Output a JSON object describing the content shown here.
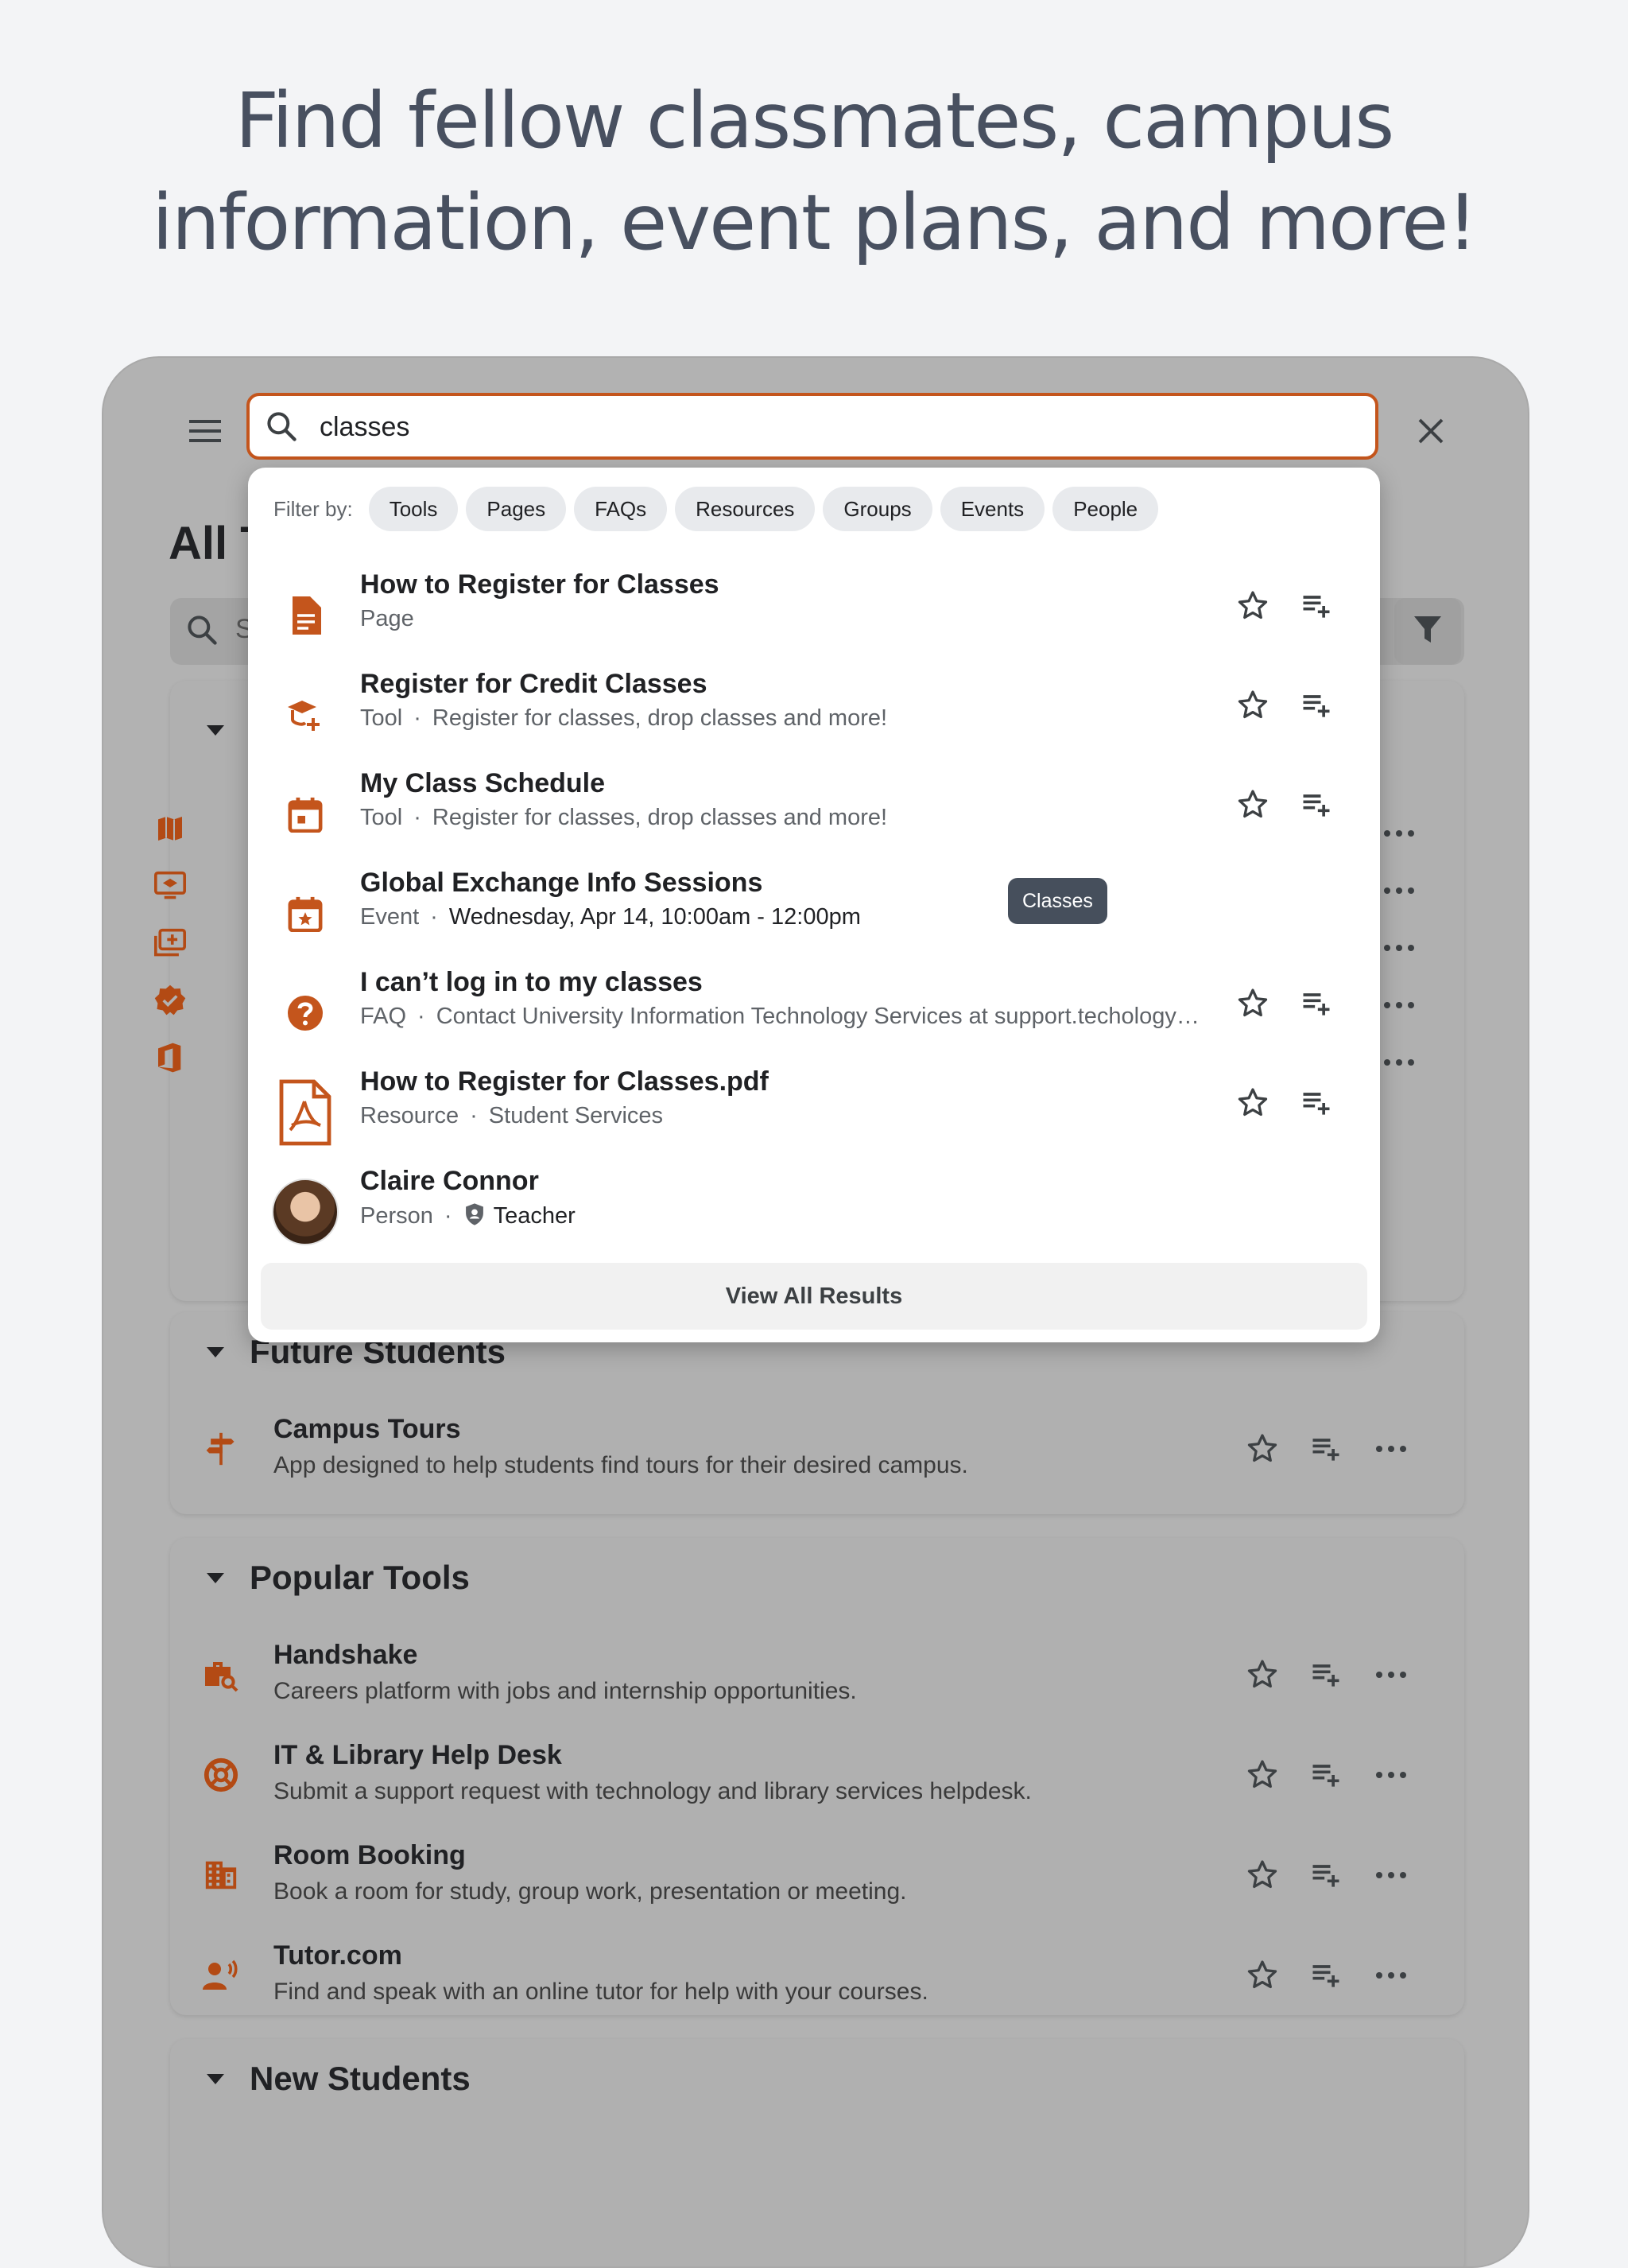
{
  "headline": {
    "line1": "Find fellow classmates, campus",
    "line2": "information, event plans, and more!"
  },
  "colors": {
    "accent": "#c4551c",
    "tooltip_bg": "#464f5c",
    "overlay": "#b2b2b2"
  },
  "topbar": {
    "menu_icon": "hamburger-menu-icon",
    "search_value": "classes",
    "close_icon": "close-icon"
  },
  "page": {
    "title_visible": "All T",
    "search_placeholder_visible": "S"
  },
  "dropdown": {
    "filter_label": "Filter by:",
    "filters": [
      "Tools",
      "Pages",
      "FAQs",
      "Resources",
      "Groups",
      "Events",
      "People"
    ],
    "results": [
      {
        "icon": "document-icon",
        "title": "How to Register for Classes",
        "type": "Page",
        "detail": ""
      },
      {
        "icon": "graduation-cap-add-icon",
        "title": "Register for Credit Classes",
        "type": "Tool",
        "detail": "Register for classes, drop classes and more!"
      },
      {
        "icon": "calendar-icon",
        "title": "My Class Schedule",
        "type": "Tool",
        "detail": "Register for classes, drop classes and more!"
      },
      {
        "icon": "calendar-star-icon",
        "title": "Global Exchange Info Sessions",
        "type": "Event",
        "detail": "Wednesday, Apr 14, 10:00am - 12:00pm"
      },
      {
        "icon": "help-circle-icon",
        "title": "I can’t log in to my classes",
        "type": "FAQ",
        "detail": "Contact University Information Technology Services at support.techology…"
      },
      {
        "icon": "pdf-file-icon",
        "title": "How to Register for Classes.pdf",
        "type": "Resource",
        "detail": "Student Services"
      },
      {
        "icon": "avatar",
        "title": "Claire Connor",
        "type": "Person",
        "detail": "Teacher",
        "detail_icon": "shield-person-icon"
      }
    ],
    "tooltip": "Classes",
    "view_all": "View All Results"
  },
  "sections": {
    "future": {
      "title": "Future Students",
      "items": [
        {
          "icon": "signpost-icon",
          "title": "Campus Tours",
          "desc": "App designed to help students find tours for their desired campus."
        }
      ]
    },
    "popular": {
      "title": "Popular Tools",
      "items": [
        {
          "icon": "work-search-icon",
          "title": "Handshake",
          "desc": "Careers platform with jobs and internship opportunities."
        },
        {
          "icon": "lifebuoy-icon",
          "title": "IT & Library Help Desk",
          "desc": "Submit a support request with technology and library services helpdesk."
        },
        {
          "icon": "building-icon",
          "title": "Room Booking",
          "desc": "Book a room for study, group work, presentation or meeting."
        },
        {
          "icon": "record-voice-icon",
          "title": "Tutor.com",
          "desc": "Find and speak with an online tutor for help with your courses."
        }
      ]
    },
    "new": {
      "title": "New Students"
    }
  }
}
